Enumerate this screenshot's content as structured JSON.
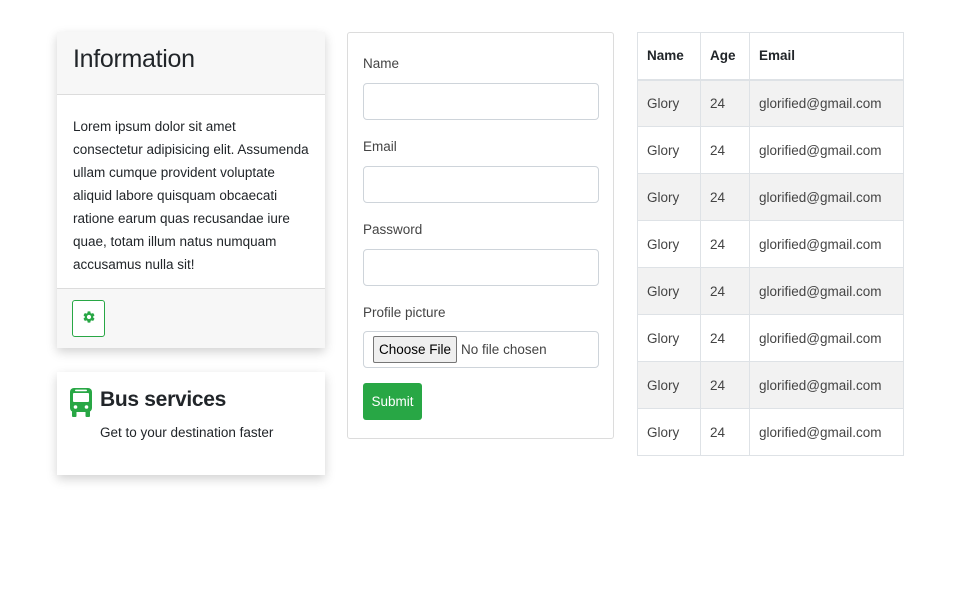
{
  "info_card": {
    "title": "Information",
    "body": "Lorem ipsum dolor sit amet consectetur adipisicing elit. Assumenda ullam cumque provident voluptate aliquid labore quisquam obcaecati ratione earum quas recusandae iure quae, totam illum natus numquam accusamus nulla sit!",
    "footer_icon": "gear-icon"
  },
  "bus_card": {
    "icon": "bus-icon",
    "title": "Bus services",
    "subtitle": "Get to your destination faster"
  },
  "form": {
    "name_label": "Name",
    "name_value": "",
    "email_label": "Email",
    "email_value": "",
    "password_label": "Password",
    "password_value": "",
    "picture_label": "Profile picture",
    "choose_file_label": "Choose File",
    "file_status": "No file chosen",
    "submit_label": "Submit"
  },
  "table": {
    "headers": [
      "Name",
      "Age",
      "Email"
    ],
    "rows": [
      [
        "Glory",
        "24",
        "glorified@gmail.com"
      ],
      [
        "Glory",
        "24",
        "glorified@gmail.com"
      ],
      [
        "Glory",
        "24",
        "glorified@gmail.com"
      ],
      [
        "Glory",
        "24",
        "glorified@gmail.com"
      ],
      [
        "Glory",
        "24",
        "glorified@gmail.com"
      ],
      [
        "Glory",
        "24",
        "glorified@gmail.com"
      ],
      [
        "Glory",
        "24",
        "glorified@gmail.com"
      ],
      [
        "Glory",
        "24",
        "glorified@gmail.com"
      ]
    ]
  },
  "colors": {
    "accent": "#28a745",
    "header_bg": "#f7f7f7",
    "stripe_bg": "#f2f2f2"
  }
}
